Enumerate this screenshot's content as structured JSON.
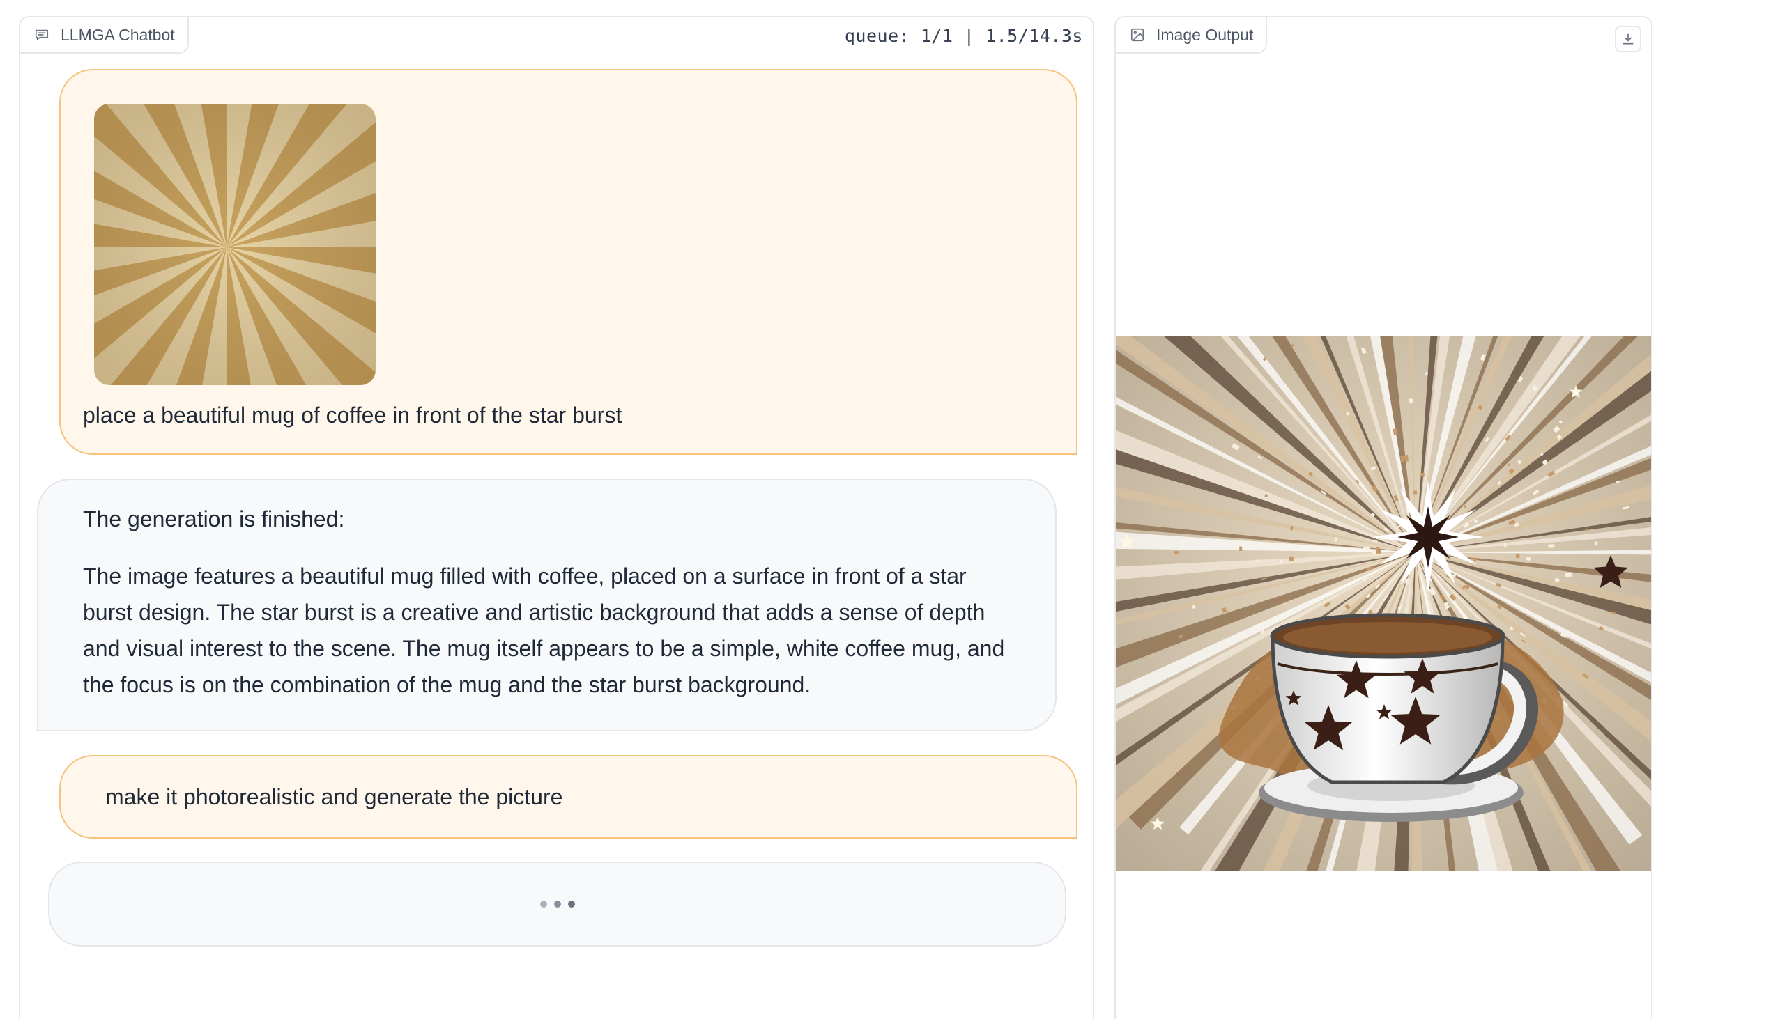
{
  "chatbot": {
    "label": "LLMGA Chatbot",
    "queue_status": "queue: 1/1 | 1.5/14.3s",
    "messages": [
      {
        "role": "user",
        "image": "starburst-image",
        "text": "place a beautiful mug of coffee in front of the star burst"
      },
      {
        "role": "bot",
        "paragraphs": [
          "The generation is finished:",
          "The image features a beautiful mug filled with coffee, placed on a surface in front of a star burst design. The star burst is a creative and artistic background that adds a sense of depth and visual interest to the scene. The mug itself appears to be a simple, white coffee mug, and the focus is on the combination of the mug and the star burst background."
        ]
      },
      {
        "role": "user",
        "text": "make it photorealistic and generate the picture"
      },
      {
        "role": "bot",
        "status": "pending"
      }
    ]
  },
  "output": {
    "label": "Image Output",
    "download_icon": "download-icon",
    "image": "coffee-mug-starburst-image"
  },
  "colors": {
    "user_bubble_bg": "#fff6ec",
    "user_bubble_border": "#f6c37e",
    "bot_bubble_bg": "#f8f9fb",
    "panel_border": "#e5e7eb"
  }
}
